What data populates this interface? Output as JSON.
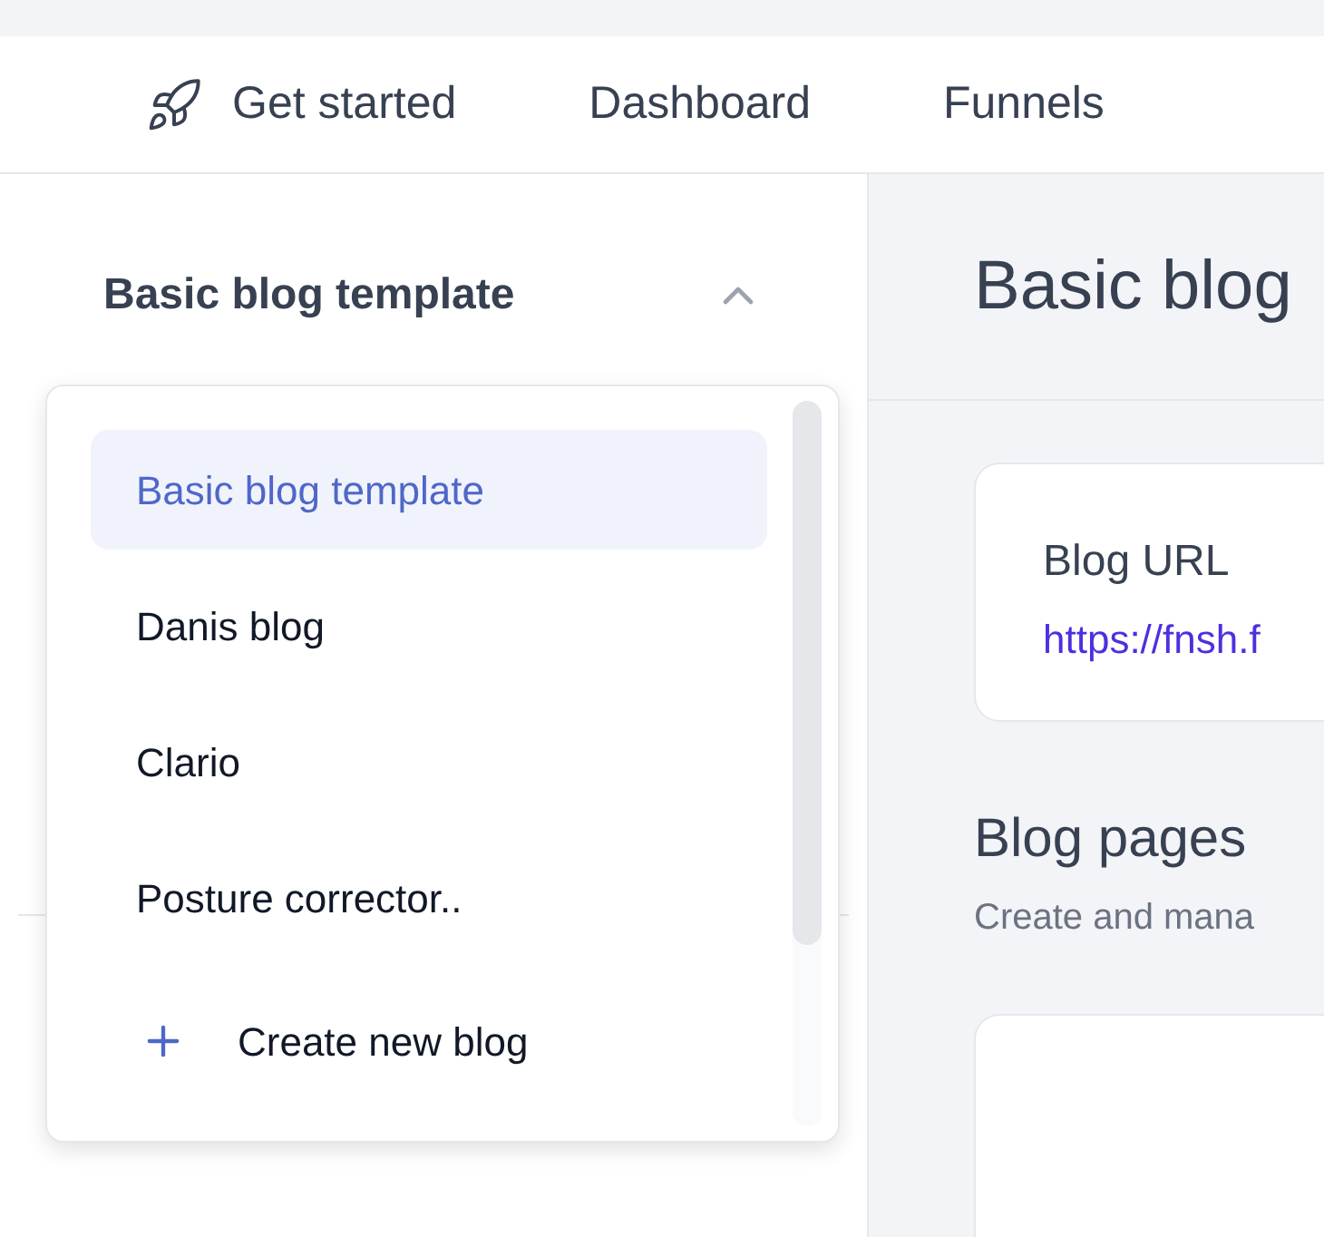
{
  "nav": [
    {
      "label": "Get started",
      "kind": "icon"
    },
    {
      "label": "Dashboard",
      "kind": "plain"
    },
    {
      "label": "Funnels",
      "kind": "plain"
    }
  ],
  "blog_selector": {
    "value": "Basic blog template",
    "expanded": true,
    "options": [
      {
        "label": "Basic blog template",
        "selected": true
      },
      {
        "label": "Danis blog",
        "selected": false
      },
      {
        "label": "Clario",
        "selected": false
      },
      {
        "label": "Posture corrector..",
        "selected": false
      }
    ],
    "create_action": "Create new blog"
  },
  "main": {
    "title": "Basic blog",
    "url_card": {
      "label": "Blog URL",
      "url": "https://fnsh.f"
    },
    "section": {
      "title": "Blog pages",
      "subtitle": "Create and mana"
    }
  }
}
